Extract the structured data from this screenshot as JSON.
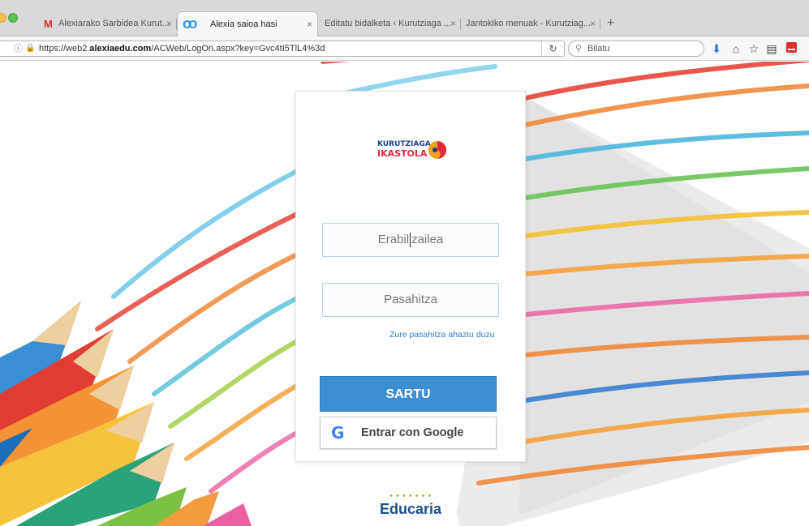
{
  "browser": {
    "tabs": [
      {
        "icon": "M",
        "icon_color": "#d93025",
        "label": "Alexiarako Sarbidea Kurut...",
        "active": false
      },
      {
        "icon": "Ꝏ",
        "icon_color": "#2a9bd8",
        "label": "Alexia saioa hasi",
        "active": true
      },
      {
        "icon": "",
        "icon_color": "#555555",
        "label": "Editatu bidalketa ‹ Kurutziaga ...",
        "active": false
      },
      {
        "icon": "",
        "icon_color": "#555555",
        "label": "Jantokiko menuak - Kurutziag...",
        "active": false
      }
    ],
    "tab_close": "×",
    "new_tab": "+",
    "url": {
      "prefix": "https://web2.",
      "domain": "alexiaedu.com",
      "path": "/ACWeb/LogOn.aspx?key=Gvc4tI5TlL4%3d"
    },
    "search_placeholder": "Bilatu"
  },
  "login": {
    "logo": {
      "line1": "KURUTZIAGA",
      "line2": "IKASTOLA"
    },
    "username_placeholder_before": "Erabil",
    "username_placeholder_after": "zailea",
    "password_placeholder": "Pasahitza",
    "forgot_link": "Zure pasahitza ahaztu duzu",
    "submit_label": "SARTU",
    "google_label": "Entrar con Google"
  },
  "footer": {
    "brand": "Educaria",
    "dots": "• • • • • • •"
  },
  "colors": {
    "accent_blue": "#3d8fd3",
    "link_blue": "#2f7fc1",
    "input_border": "#b9d2e3",
    "brand_navy": "#1e4f8a",
    "brand_green": "#9ac33d"
  },
  "icons": {
    "info": "info-icon",
    "lock": "lock-icon",
    "reload": "reload-icon",
    "search": "search-icon",
    "download": "download-icon",
    "home": "home-icon",
    "bookmark": "bookmark-star-icon",
    "reading_list": "reading-list-icon",
    "pdf": "pdf-icon",
    "google": "google-icon"
  }
}
